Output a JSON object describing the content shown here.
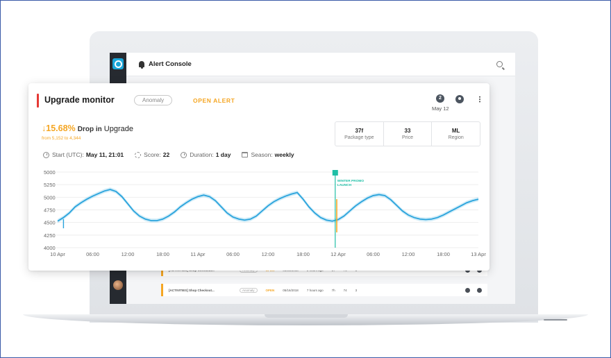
{
  "app": {
    "header_title": "Alert Console"
  },
  "background_rows": [
    {
      "title": "[ACTIVITIES] Shop Checkout...",
      "badge": "Anomaly",
      "status": "OPEN",
      "date": "05/16/2018",
      "ago": "2 hours ago",
      "c1": "37",
      "c2": "74",
      "c3": "3"
    },
    {
      "title": "[ACTIVITIES] Shop Checkout...",
      "badge": "Anomaly",
      "status": "OPEN",
      "date": "05/16/2018",
      "ago": "7 hours ago",
      "c1": "7h",
      "c2": "74",
      "c3": "3"
    }
  ],
  "card": {
    "title": "Upgrade monitor",
    "chip": "Anomaly",
    "action": "OPEN ALERT",
    "alert_count": "2",
    "date": "May 12",
    "drop_arrow": "↓",
    "drop_value": "15.68%",
    "drop_text": "Drop in",
    "drop_metric": "Upgrade",
    "drop_sub": "from 5,152 to 4,344",
    "dimensions": [
      {
        "value": "37f",
        "label": "Package type"
      },
      {
        "value": "33",
        "label": "Price"
      },
      {
        "value": "ML",
        "label": "Region"
      }
    ],
    "meta": {
      "start_label": "Start (UTC):",
      "start_value": "May 11, 21:01",
      "score_label": "Score:",
      "score_value": "22",
      "duration_label": "Duration:",
      "duration_value": "1 day",
      "season_label": "Season:",
      "season_value": "weekly"
    }
  },
  "colors": {
    "accent": "#e53935",
    "warning": "#f5a623",
    "series": "#29a3dc",
    "band": "#a9dcf2",
    "event": "#1fbfa6"
  },
  "chart_data": {
    "type": "line",
    "ylim": [
      4000,
      5000
    ],
    "y_ticks": [
      "5000",
      "5250",
      "5000",
      "4750",
      "4500",
      "4250",
      "4000"
    ],
    "x_ticks": [
      "10 Apr",
      "06:00",
      "12:00",
      "18:00",
      "11 Apr",
      "06:00",
      "12:00",
      "18:00",
      "12 Apr",
      "06:00",
      "12:00",
      "18:00",
      "13 Apr"
    ],
    "x_hours": [
      0,
      6,
      12,
      18,
      24,
      30,
      36,
      42,
      48,
      54,
      60,
      66,
      72
    ],
    "series": [
      {
        "x": [
          0,
          1,
          2,
          3,
          4,
          5,
          6,
          7,
          8,
          9,
          10,
          11,
          12,
          13,
          14,
          15,
          16,
          17,
          18,
          19,
          20,
          21,
          22,
          23,
          24,
          25,
          26,
          27,
          28,
          29,
          30,
          31,
          32,
          33,
          34,
          35,
          36,
          37,
          38,
          39,
          40,
          41,
          42,
          43,
          44,
          45,
          46,
          47,
          48,
          49,
          50,
          51,
          52,
          53,
          54,
          55,
          56,
          57,
          58,
          59,
          60,
          61,
          62,
          63,
          64,
          65,
          66,
          67,
          68,
          69,
          70,
          71,
          72
        ],
        "y": [
          4520,
          4590,
          4680,
          4800,
          4880,
          4950,
          5010,
          5060,
          5110,
          5140,
          5100,
          5000,
          4860,
          4720,
          4620,
          4560,
          4530,
          4530,
          4560,
          4620,
          4700,
          4800,
          4880,
          4950,
          5000,
          5030,
          5000,
          4920,
          4800,
          4680,
          4600,
          4560,
          4540,
          4560,
          4620,
          4720,
          4820,
          4900,
          4960,
          5010,
          5050,
          5080,
          4950,
          4800,
          4680,
          4590,
          4540,
          4520,
          4550,
          4620,
          4720,
          4820,
          4900,
          4970,
          5020,
          5040,
          5020,
          4940,
          4830,
          4720,
          4640,
          4590,
          4560,
          4550,
          4560,
          4590,
          4640,
          4700,
          4760,
          4820,
          4880,
          4920,
          4950
        ]
      }
    ],
    "annotations": [
      {
        "label_line1": "WINTER PROMO",
        "label_line2": "LAUNCH",
        "x_hour": 47.5
      },
      {
        "type": "spike",
        "x_hour": 1,
        "y": 4380
      },
      {
        "type": "spike",
        "x_hour": 48,
        "y": 4300
      }
    ]
  }
}
